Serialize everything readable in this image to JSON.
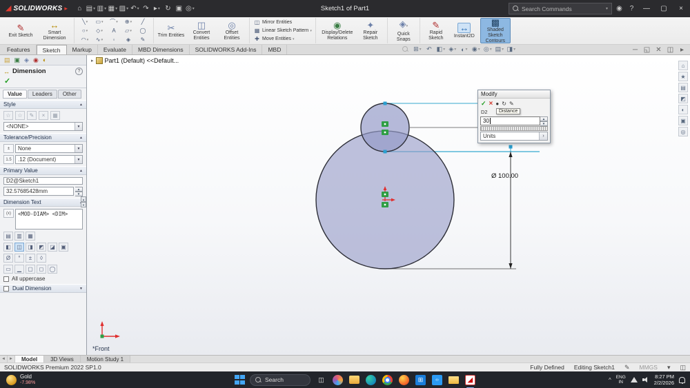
{
  "titlebar": {
    "brand": "SOLIDWORKS",
    "title": "Sketch1 of Part1",
    "search_placeholder": "Search Commands"
  },
  "tabs": {
    "items": [
      "Features",
      "Sketch",
      "Markup",
      "Evaluate",
      "MBD Dimensions",
      "SOLIDWORKS Add-Ins",
      "MBD"
    ],
    "active": "Sketch"
  },
  "ribbon": {
    "exit_sketch": "Exit Sketch",
    "smart_dimension": "Smart Dimension",
    "trim_entities": "Trim Entities",
    "convert_entities": "Convert Entities",
    "offset_entities": "Offset Entities",
    "mirror_entities": "Mirror Entities",
    "linear_sketch_pattern": "Linear Sketch Pattern",
    "move_entities": "Move Entities",
    "display_delete_relations": "Display/Delete Relations",
    "repair_sketch": "Repair Sketch",
    "quick_snaps": "Quick Snaps",
    "rapid_sketch": "Rapid Sketch",
    "instant2d": "Instant2D",
    "shaded_sketch_contours": "Shaded Sketch Contours"
  },
  "property_panel": {
    "title": "Dimension",
    "tabs": [
      "Value",
      "Leaders",
      "Other"
    ],
    "style_header": "Style",
    "style_value": "<NONE>",
    "tolerance_header": "Tolerance/Precision",
    "tolerance_value": "None",
    "precision_value": ".12 (Document)",
    "primary_header": "Primary Value",
    "dim_name": "D2@Sketch1",
    "dim_value": "32.57685428mm",
    "dimension_text_header": "Dimension Text",
    "dimension_text_value": "<MOD-DIAM> <DIM>",
    "all_uppercase_label": "All uppercase",
    "dual_dimension_header": "Dual Dimension"
  },
  "viewport": {
    "feature_tree_item": "Part1 (Default) <<Default...",
    "dimension_label": "Ø 100.00",
    "view_label": "*Front",
    "modify_dialog": {
      "title": "Modify",
      "dim_name": "D2",
      "tooltip": "Distance",
      "value": "30",
      "units_label": "Units"
    }
  },
  "bottom_tabs": [
    "Model",
    "3D Views",
    "Motion Study 1"
  ],
  "statusbar": {
    "app_version": "SOLIDWORKS Premium 2022 SP1.0",
    "constraint_state": "Fully Defined",
    "edit_mode": "Editing Sketch1",
    "unit_system": "MMGS"
  },
  "taskbar": {
    "widget_title": "Gold",
    "widget_value": "-7.98%",
    "search_label": "Search",
    "language_top": "ENG",
    "language_bottom": "IN",
    "time": "8:27 PM",
    "date": "2/2/2026"
  },
  "sketch": {
    "large_circle_diameter": 100.0,
    "dimension_being_edited": "D2",
    "new_value": 30
  }
}
